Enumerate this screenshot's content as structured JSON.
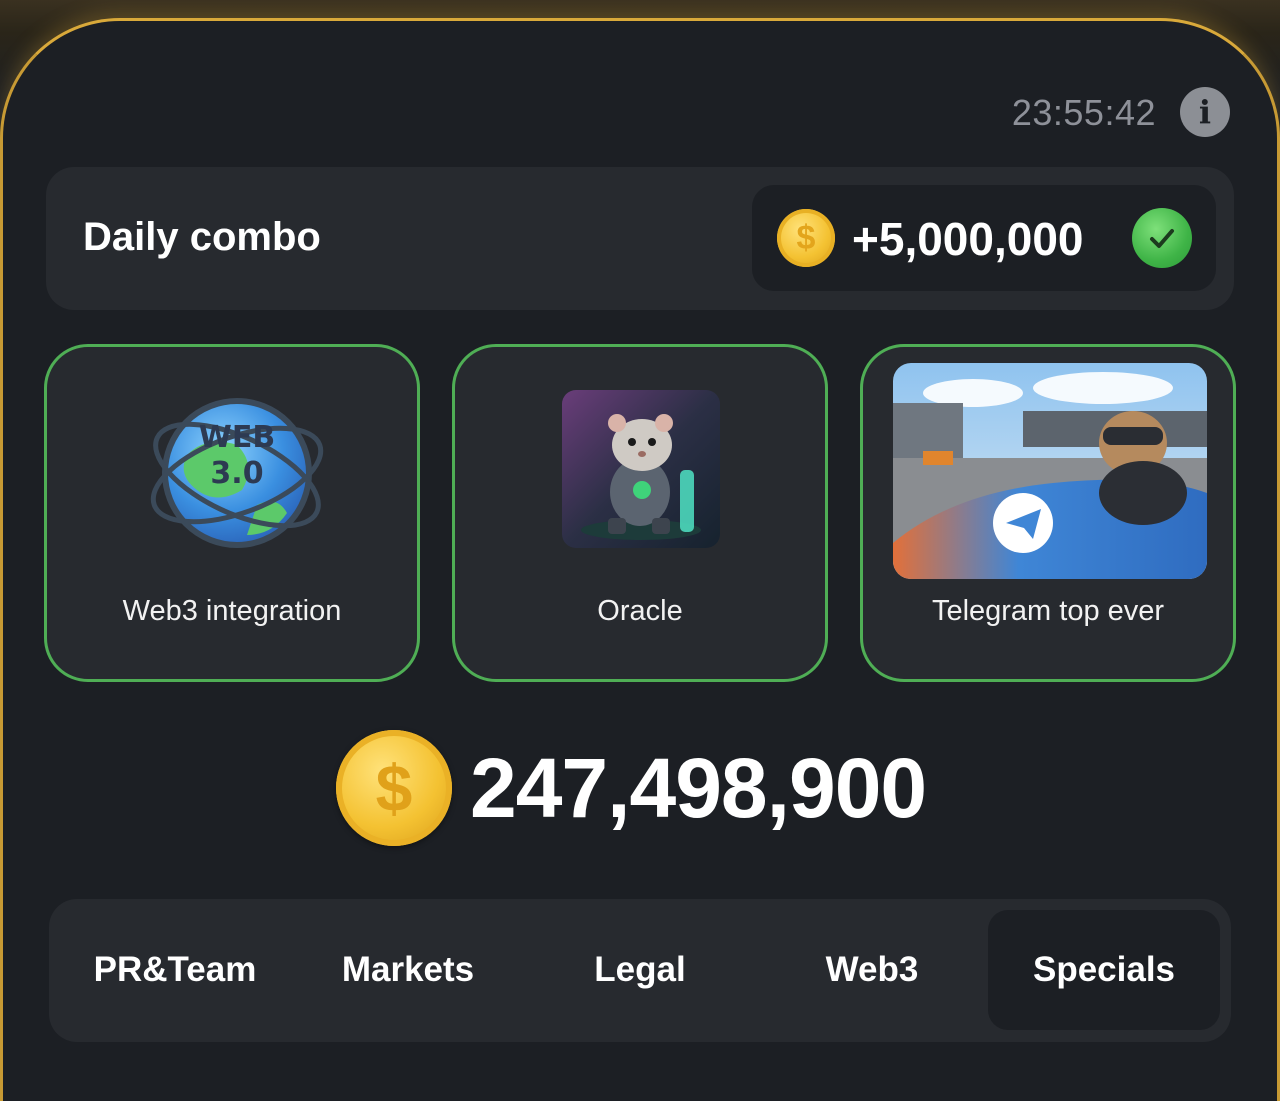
{
  "header": {
    "timer": "23:55:42",
    "info_icon": "info-icon"
  },
  "daily_combo": {
    "title": "Daily combo",
    "reward": "+5,000,000",
    "coin_symbol": "$",
    "completed": true,
    "check_icon": "check-icon"
  },
  "cards": [
    {
      "label": "Web3 integration",
      "image": "web3-globe-icon",
      "image_text_1": "WEB",
      "image_text_2": "3.0"
    },
    {
      "label": "Oracle",
      "image": "hamster-robot-image"
    },
    {
      "label": "Telegram top ever",
      "image": "hamster-race-car-image"
    }
  ],
  "balance": {
    "value": "247,498,900",
    "coin_symbol": "$"
  },
  "tabs": [
    {
      "label": "PR&Team",
      "active": false
    },
    {
      "label": "Markets",
      "active": false
    },
    {
      "label": "Legal",
      "active": false
    },
    {
      "label": "Web3",
      "active": false
    },
    {
      "label": "Specials",
      "active": true
    }
  ],
  "colors": {
    "background": "#1c1f24",
    "panel": "#272a2f",
    "accent_gold": "#d9a93a",
    "card_border": "#4fae55",
    "coin": "#f4c232",
    "check_green": "#3fb447"
  }
}
